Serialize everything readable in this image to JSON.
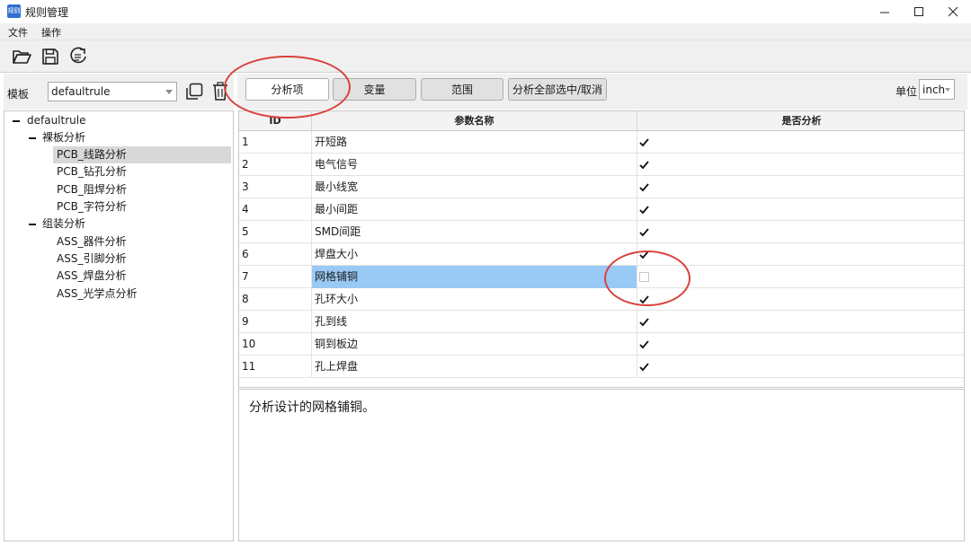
{
  "window": {
    "title": "规则管理",
    "app_icon_text": "规则"
  },
  "menu": [
    "文件",
    "操作"
  ],
  "toolbar": {
    "icons": [
      "folder-open-icon",
      "save-icon",
      "refresh-icon"
    ]
  },
  "left_panel": {
    "template_label": "模板",
    "template_value": "defaultrule",
    "tree": {
      "root": "defaultrule",
      "groups": [
        {
          "label": "裸板分析",
          "items": [
            "PCB_线路分析",
            "PCB_钻孔分析",
            "PCB_阻焊分析",
            "PCB_字符分析"
          ]
        },
        {
          "label": "组装分析",
          "items": [
            "ASS_器件分析",
            "ASS_引脚分析",
            "ASS_焊盘分析",
            "ASS_光学点分析"
          ]
        }
      ],
      "selected": "PCB_线路分析"
    }
  },
  "tabs": [
    "分析项",
    "变量",
    "范围"
  ],
  "select_all_button": "分析全部选中/取消",
  "unit": {
    "label": "单位",
    "value": "inch"
  },
  "grid": {
    "columns": [
      "ID",
      "参数名称",
      "是否分析"
    ],
    "rows": [
      {
        "id": "1",
        "name": "开短路",
        "checked": true
      },
      {
        "id": "2",
        "name": "电气信号",
        "checked": true
      },
      {
        "id": "3",
        "name": "最小线宽",
        "checked": true
      },
      {
        "id": "4",
        "name": "最小间距",
        "checked": true
      },
      {
        "id": "5",
        "name": "SMD间距",
        "checked": true
      },
      {
        "id": "6",
        "name": "焊盘大小",
        "checked": true
      },
      {
        "id": "7",
        "name": "网格铺铜",
        "checked": false,
        "selected": true
      },
      {
        "id": "8",
        "name": "孔环大小",
        "checked": true
      },
      {
        "id": "9",
        "name": "孔到线",
        "checked": true
      },
      {
        "id": "10",
        "name": "铜到板边",
        "checked": true
      },
      {
        "id": "11",
        "name": "孔上焊盘",
        "checked": true
      }
    ]
  },
  "description": "分析设计的网格铺铜。",
  "colors": {
    "selection": "#99c9f5",
    "annotation": "#d9413b",
    "app_icon": "#2f6fd0"
  }
}
